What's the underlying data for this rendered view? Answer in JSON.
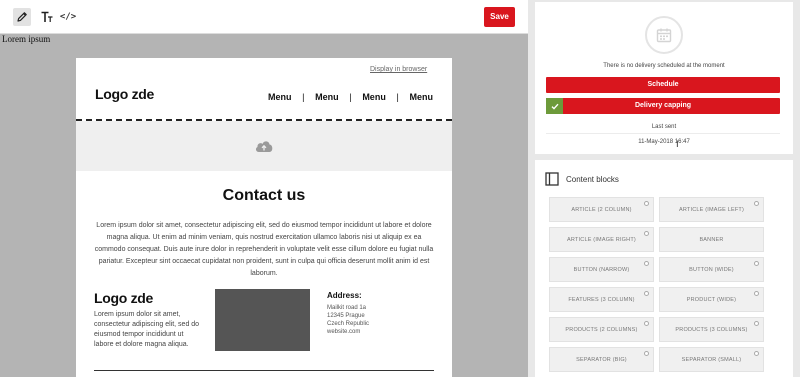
{
  "toolbar": {
    "tools": [
      {
        "icon": "pencil-icon",
        "active": true
      },
      {
        "icon": "typography-icon",
        "active": false
      },
      {
        "icon": "code-icon",
        "label": "</>"
      }
    ],
    "save_label": "Save"
  },
  "canvas": {
    "preheader": "Lorem ipsum"
  },
  "email": {
    "display_link": "Display in browser",
    "logo": "Logo zde",
    "nav": [
      "Menu",
      "Menu",
      "Menu",
      "Menu"
    ],
    "nav_separator": "|",
    "image_icon": "cloud-upload-icon",
    "contact_heading": "Contact us",
    "contact_text": "Lorem ipsum dolor sit amet, consectetur adipiscing elit, sed do eiusmod tempor incididunt ut labore et dolore magna aliqua. Ut enim ad minim veniam, quis nostrud exercitation ullamco laboris nisi ut aliquip ex ea commodo consequat. Duis aute irure dolor in reprehenderit in voluptate velit esse cillum dolore eu fugiat nulla pariatur. Excepteur sint occaecat cupidatat non proident, sunt in culpa qui officia deserunt mollit anim id est laborum.",
    "footer": {
      "logo": "Logo zde",
      "text": "Lorem ipsum dolor sit amet, consectetur adipiscing elit, sed do eiusmod tempor incididunt ut labore et dolore magna aliqua.",
      "address_label": "Address:",
      "address_lines": [
        "Mailkit road 1a",
        "12345 Prague",
        "Czech Republic",
        "website.com"
      ]
    }
  },
  "delivery": {
    "icon": "calendar-icon",
    "no_delivery_text": "There is no delivery scheduled at the moment",
    "schedule_label": "Schedule",
    "capping_label": "Delivery capping",
    "capping_icon": "check-icon",
    "last_sent_label": "Last sent",
    "last_sent_date": "11-May-2018 16:47"
  },
  "content_blocks": {
    "icon": "book-icon",
    "title": "Content blocks",
    "blocks": [
      "ARTICLE (2 COLUMN)",
      "ARTICLE (IMAGE LEFT)",
      "ARTICLE (IMAGE RIGHT)",
      "BANNER",
      "BUTTON (NARROW)",
      "BUTTON (WIDE)",
      "FEATURES (3 COLUMN)",
      "PRODUCT (WIDE)",
      "PRODUCTS (2 COLUMNS)",
      "PRODUCTS (3 COLUMNS)",
      "SEPARATOR (BIG)",
      "SEPARATOR (SMALL)"
    ]
  },
  "colors": {
    "accent_red": "#d9161e",
    "success_green": "#6d9a3a",
    "canvas_gray": "#b4b4b4"
  }
}
